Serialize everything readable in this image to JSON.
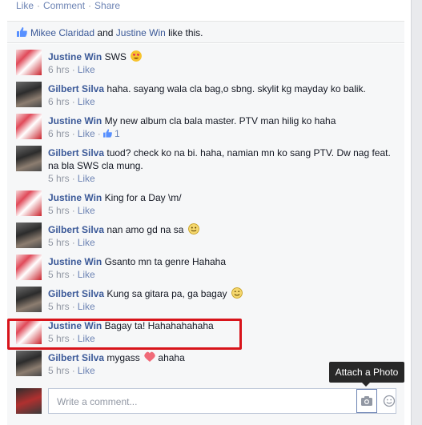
{
  "actions": {
    "like": "Like",
    "comment": "Comment",
    "share": "Share",
    "sep": "·"
  },
  "likes": {
    "user1": "Mikee Claridad",
    "and": "and",
    "user2": "Justine Win",
    "suffix": "like this."
  },
  "comments": [
    {
      "author": "Justine Win",
      "text": "SWS",
      "time": "6 hrs",
      "like": "Like",
      "emoji": "heart-eyes",
      "like_count": ""
    },
    {
      "author": "Gilbert Silva",
      "text": "haha. sayang wala cla bag,o sbng. skylit kg mayday ko balik.",
      "time": "6 hrs",
      "like": "Like",
      "like_count": ""
    },
    {
      "author": "Justine Win",
      "text": "My new album cla bala master. PTV man hilig ko haha",
      "time": "6 hrs",
      "like": "Like",
      "like_count": "1"
    },
    {
      "author": "Gilbert Silva",
      "text": "tuod? check ko na bi. haha, namian mn ko sang PTV. Dw nag feat. na bla SWS cla mung.",
      "time": "5 hrs",
      "like": "Like",
      "like_count": ""
    },
    {
      "author": "Justine Win",
      "text": "King for a Day \\m/",
      "time": "5 hrs",
      "like": "Like",
      "like_count": ""
    },
    {
      "author": "Gilbert Silva",
      "text": "nan amo gd na sa",
      "time": "5 hrs",
      "like": "Like",
      "emoji": "grin",
      "like_count": ""
    },
    {
      "author": "Justine Win",
      "text": "Gsanto mn ta genre Hahaha",
      "time": "5 hrs",
      "like": "Like",
      "like_count": ""
    },
    {
      "author": "Gilbert Silva",
      "text": "Kung sa gitara pa, ga bagay",
      "time": "5 hrs",
      "like": "Like",
      "emoji": "smile",
      "like_count": ""
    },
    {
      "author": "Justine Win",
      "text": "Bagay ta! Hahahahahaha",
      "time": "5 hrs",
      "like": "Like",
      "like_count": ""
    },
    {
      "author": "Gilbert Silva",
      "text": "mygass",
      "text2": "ahaha",
      "time": "5 hrs",
      "like": "Like",
      "emoji": "heart",
      "like_count": ""
    }
  ],
  "compose": {
    "placeholder": "Write a comment...",
    "camera_icon": "camera-icon",
    "emoji_icon": "smiley-icon"
  },
  "tooltip": "Attach a Photo",
  "colors": {
    "link": "#3b5998",
    "highlight": "#d8141b"
  }
}
